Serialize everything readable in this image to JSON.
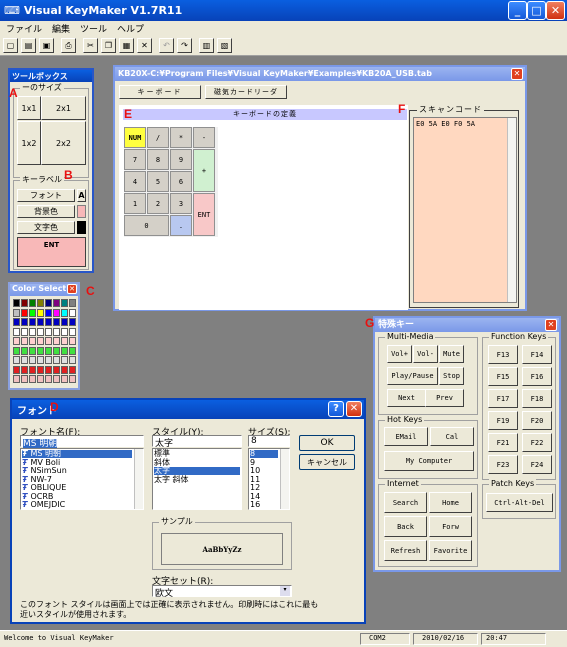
{
  "window": {
    "title": "Visual KeyMaker V1.7R11"
  },
  "menu": [
    "ファイル",
    "編集",
    "ツール",
    "ヘルプ"
  ],
  "toolbox": {
    "title": "ツールボックス",
    "size_group": "ーのサイズ",
    "sizes": [
      "1x1",
      "2x1",
      "1x2",
      "2x2"
    ],
    "label_group": "キーラベル",
    "font": "フォント",
    "font_sample": "A",
    "bg": "背景色",
    "fg": "文字色",
    "preview": "ENT"
  },
  "color_select": {
    "title": "Color Select"
  },
  "doc": {
    "title": "KB20X-C:¥Program Files¥Visual KeyMaker¥Examples¥KB20A_USB.tab",
    "tab1": "キーボード",
    "tab2": "磁気カードリーダ",
    "keyboard_header": "キーボードの定義",
    "scan_label": "スキャンコード",
    "scan_value": "E0 5A E0 F0 5A"
  },
  "keypad": [
    "NUM",
    "/",
    "*",
    "-",
    "7",
    "8",
    "9",
    "+",
    "4",
    "5",
    "6",
    "1",
    "2",
    "3",
    "ENT",
    "0",
    "."
  ],
  "special": {
    "title": "特殊キー",
    "multimedia": "Multi-Media",
    "mm_keys": [
      "Vol+",
      "Vol-",
      "Mute",
      "Play/Pause",
      "Stop",
      "Next",
      "Prev"
    ],
    "function": "Function Keys",
    "fn_keys": [
      "F13",
      "F14",
      "F15",
      "F16",
      "F17",
      "F18",
      "F19",
      "F20",
      "F21",
      "F22",
      "F23",
      "F24"
    ],
    "hotkeys": "Hot Keys",
    "hk_keys": [
      "EMail",
      "Cal",
      "My Computer"
    ],
    "patch": "Patch Keys",
    "patch_key": "Ctrl-Alt-Del",
    "internet": "Internet",
    "inet_keys": [
      "Search",
      "Home",
      "Back",
      "Forw",
      "Refresh",
      "Favorite"
    ]
  },
  "font_dialog": {
    "title": "フォント",
    "font_label": "フォント名(F):",
    "font_value": "MS 明朝",
    "fonts": [
      "MS 明朝",
      "MV Boli",
      "NSimSun",
      "NW-7",
      "OBLIQUE",
      "OCRB",
      "OMEJDIC"
    ],
    "style_label": "スタイル(Y):",
    "style_value": "太字",
    "styles": [
      "標準",
      "斜体",
      "太字",
      "太字 斜体"
    ],
    "size_label": "サイズ(S):",
    "size_value": "8",
    "sizes": [
      "8",
      "9",
      "10",
      "11",
      "12",
      "14",
      "16"
    ],
    "ok": "OK",
    "cancel": "キャンセル",
    "sample_label": "サンプル",
    "sample_text": "AaBbYyZz",
    "charset_label": "文字セット(R):",
    "charset_value": "欧文",
    "note": "このフォント スタイルは画面上では正確に表示されません。印刷時にはこれに最も近いスタイルが使用されます。"
  },
  "status": {
    "msg": "Welcome to Visual KeyMaker",
    "port": "COM2",
    "date": "2010/02/16",
    "time": "20:47"
  },
  "letters": [
    "A",
    "B",
    "C",
    "D",
    "E",
    "F",
    "G"
  ]
}
